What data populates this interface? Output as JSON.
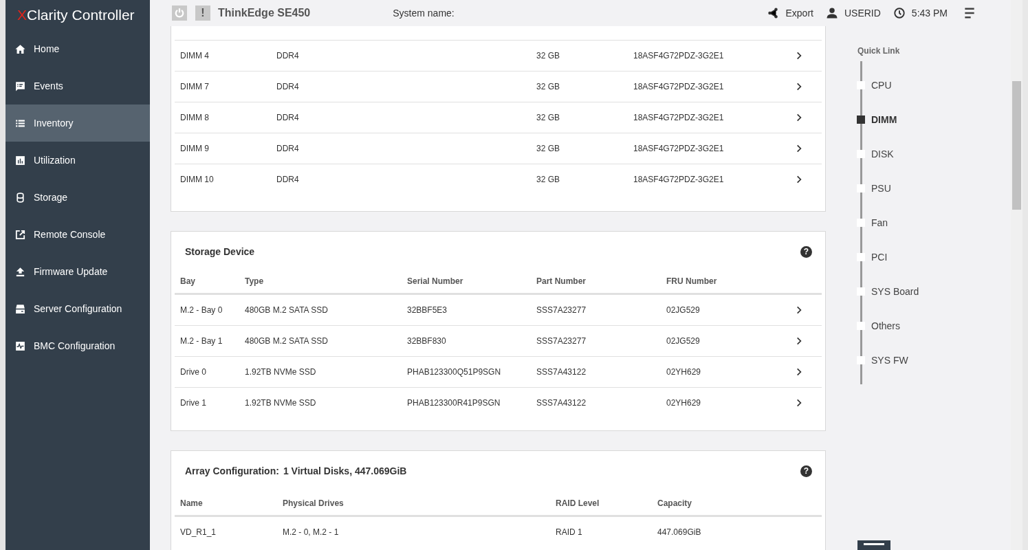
{
  "logo": {
    "mark": "X",
    "brand": "Clarity",
    "product": "Controller"
  },
  "sidebar": {
    "items": [
      {
        "label": "Home",
        "selected": false
      },
      {
        "label": "Events",
        "selected": false
      },
      {
        "label": "Inventory",
        "selected": true
      },
      {
        "label": "Utilization",
        "selected": false
      },
      {
        "label": "Storage",
        "selected": false
      },
      {
        "label": "Remote Console",
        "selected": false
      },
      {
        "label": "Firmware Update",
        "selected": false
      },
      {
        "label": "Server Configuration",
        "selected": false
      },
      {
        "label": "BMC Configuration",
        "selected": false
      }
    ]
  },
  "header": {
    "alert_button": "!",
    "title": "ThinkEdge SE450",
    "system_name_label": "System name:",
    "export": "Export",
    "user": "USERID",
    "time": "5:43 PM"
  },
  "dimm_table": {
    "rows": [
      [
        "DIMM 4",
        "DDR4",
        "32 GB",
        "18ASF4G72PDZ-3G2E1"
      ],
      [
        "DIMM 7",
        "DDR4",
        "32 GB",
        "18ASF4G72PDZ-3G2E1"
      ],
      [
        "DIMM 8",
        "DDR4",
        "32 GB",
        "18ASF4G72PDZ-3G2E1"
      ],
      [
        "DIMM 9",
        "DDR4",
        "32 GB",
        "18ASF4G72PDZ-3G2E1"
      ],
      [
        "DIMM 10",
        "DDR4",
        "32 GB",
        "18ASF4G72PDZ-3G2E1"
      ]
    ]
  },
  "storage_device": {
    "title": "Storage Device",
    "help": "?",
    "columns": [
      "Bay",
      "Type",
      "Serial Number",
      "Part Number",
      "FRU Number"
    ],
    "rows": [
      [
        "M.2 - Bay 0",
        "480GB M.2 SATA SSD",
        "32BBF5E3",
        "SSS7A23277",
        "02JG529"
      ],
      [
        "M.2 - Bay 1",
        "480GB M.2 SATA SSD",
        "32BBF830",
        "SSS7A23277",
        "02JG529"
      ],
      [
        "Drive 0",
        "1.92TB NVMe SSD",
        "PHAB123300Q51P9SGN",
        "SSS7A43122",
        "02YH629"
      ],
      [
        "Drive 1",
        "1.92TB NVMe SSD",
        "PHAB123300R41P9SGN",
        "SSS7A43122",
        "02YH629"
      ]
    ]
  },
  "array_configuration": {
    "title": "Array Configuration:",
    "summary": "1 Virtual Disks, 447.069GiB",
    "help": "?",
    "columns": [
      "Name",
      "Physical Drives",
      "RAID Level",
      "Capacity"
    ],
    "rows": [
      [
        "VD_R1_1",
        "M.2 - 0, M.2 - 1",
        "RAID 1",
        "447.069GiB"
      ]
    ]
  },
  "quick_link": {
    "title": "Quick Link",
    "items": [
      {
        "label": "CPU",
        "selected": false
      },
      {
        "label": "DIMM",
        "selected": true
      },
      {
        "label": "DISK",
        "selected": false
      },
      {
        "label": "PSU",
        "selected": false
      },
      {
        "label": "Fan",
        "selected": false
      },
      {
        "label": "PCI",
        "selected": false
      },
      {
        "label": "SYS Board",
        "selected": false
      },
      {
        "label": "Others",
        "selected": false
      },
      {
        "label": "SYS FW",
        "selected": false
      }
    ]
  }
}
